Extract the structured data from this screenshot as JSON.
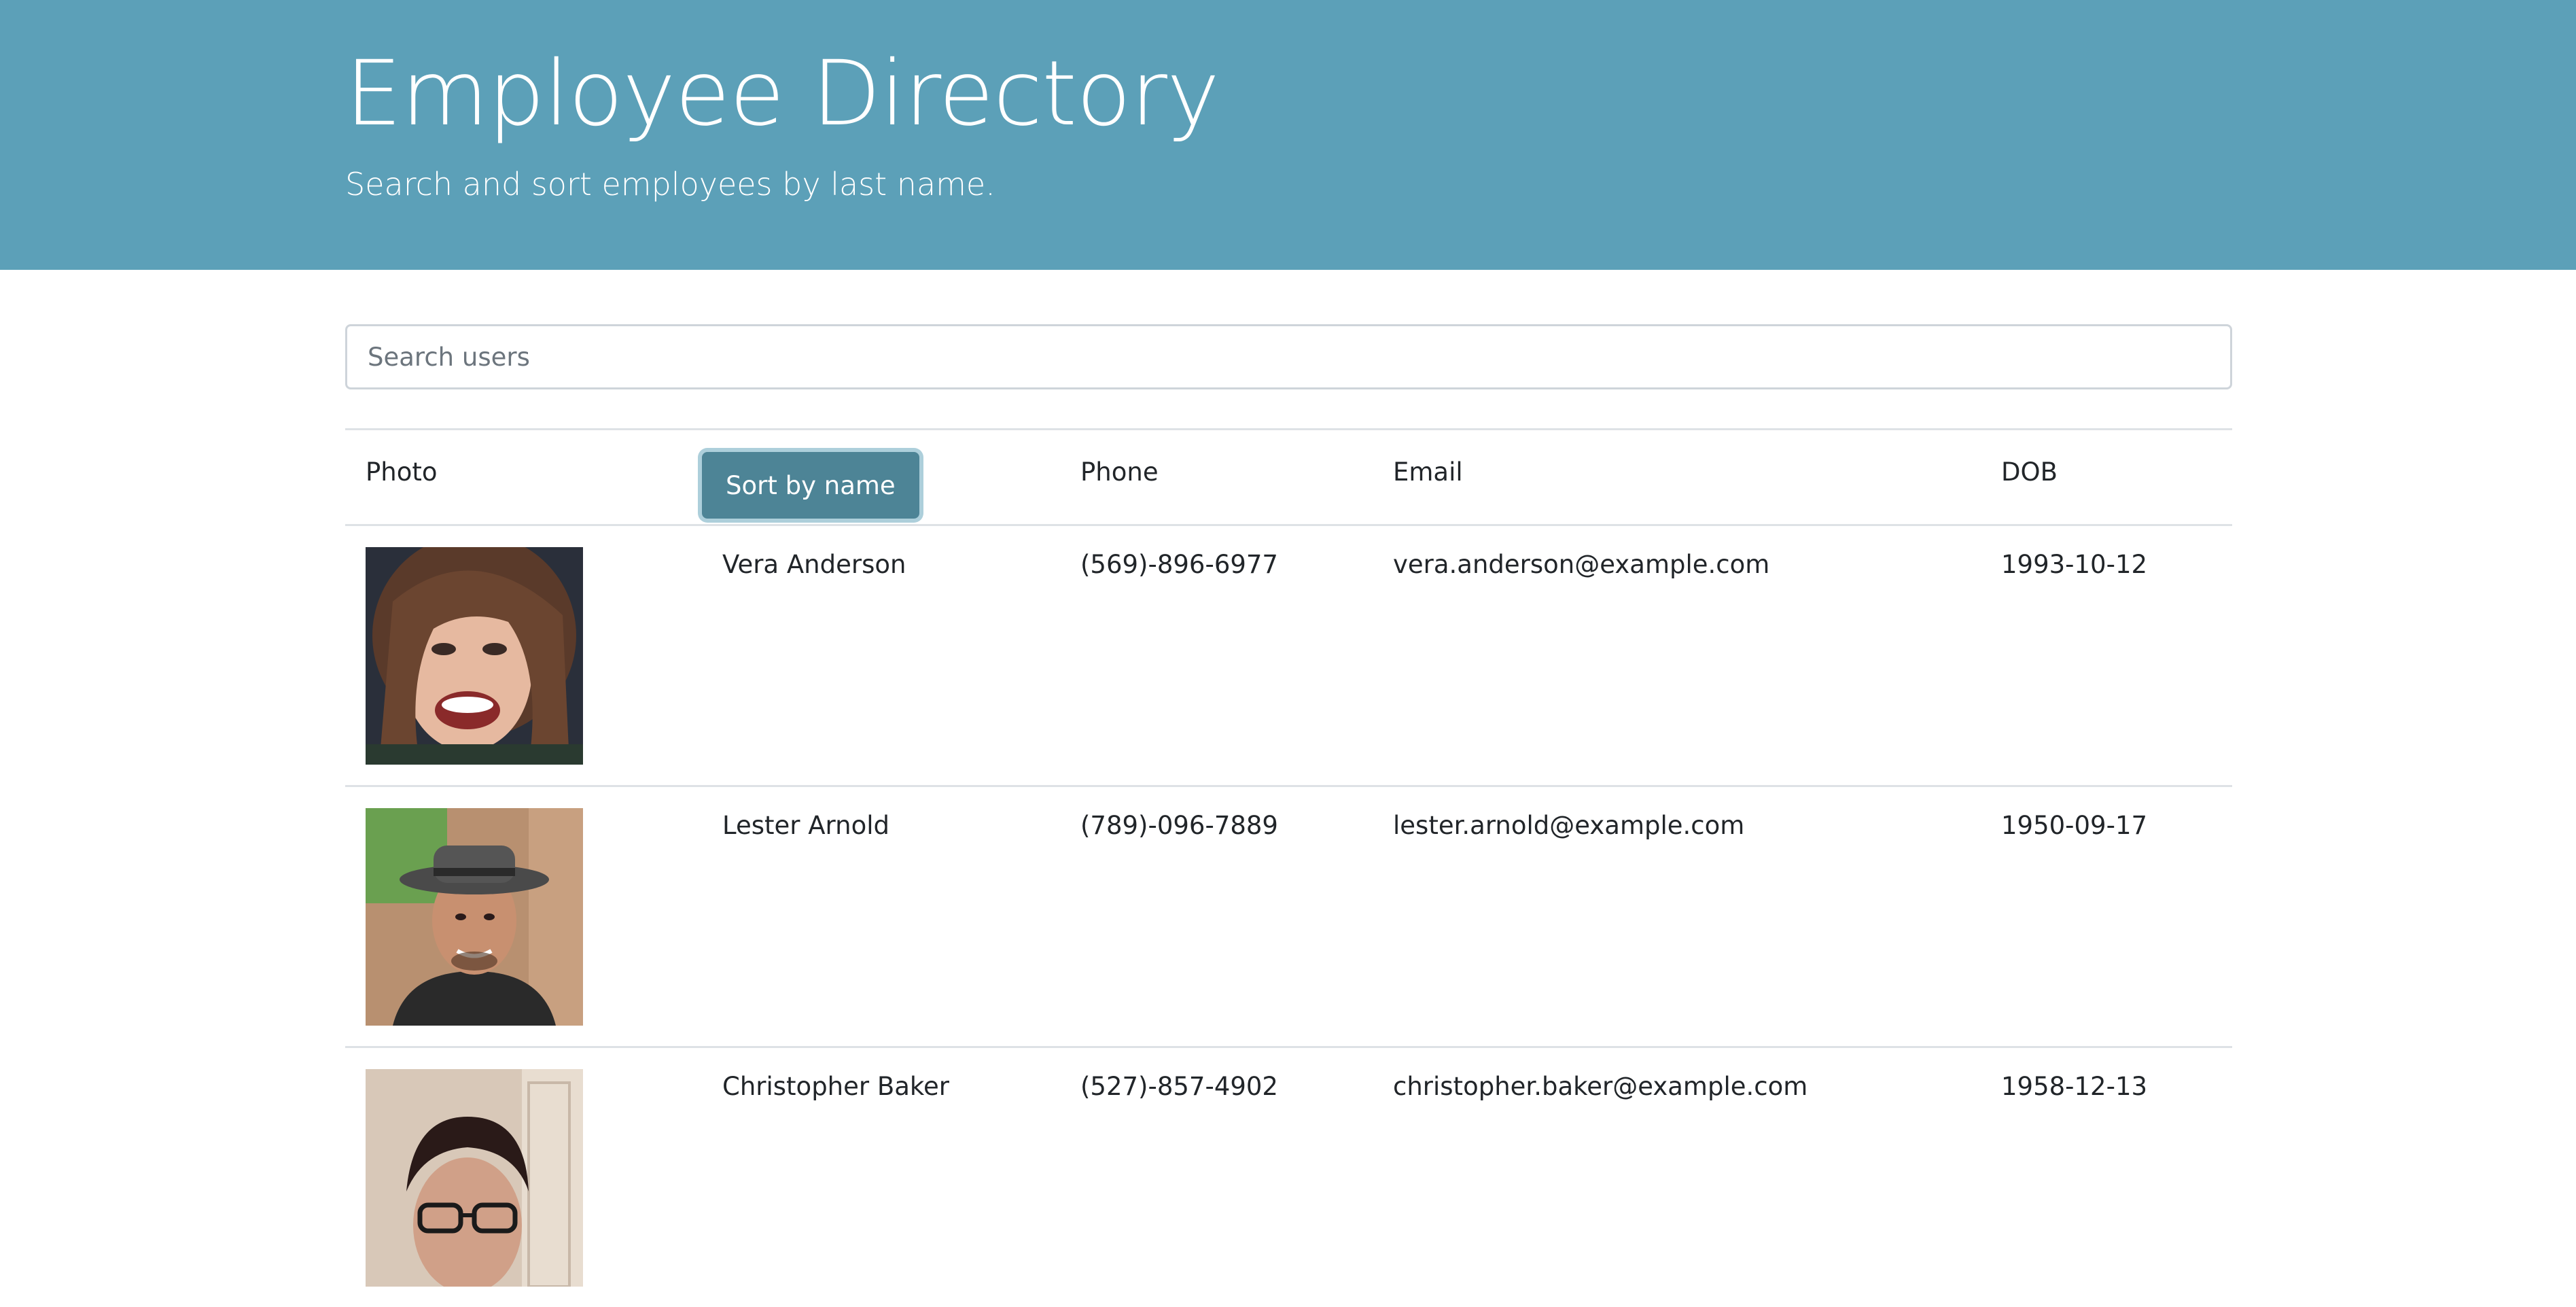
{
  "header": {
    "title": "Employee Directory",
    "subtitle": "Search and sort employees by last name."
  },
  "search": {
    "placeholder": "Search users",
    "value": ""
  },
  "table": {
    "headers": {
      "photo": "Photo",
      "sort_button": "Sort by name",
      "phone": "Phone",
      "email": "Email",
      "dob": "DOB"
    },
    "rows": [
      {
        "name": "Vera Anderson",
        "phone": "(569)-896-6977",
        "email": "vera.anderson@example.com",
        "dob": "1993-10-12",
        "photo_alt": "Vera Anderson photo"
      },
      {
        "name": "Lester Arnold",
        "phone": "(789)-096-7889",
        "email": "lester.arnold@example.com",
        "dob": "1950-09-17",
        "photo_alt": "Lester Arnold photo"
      },
      {
        "name": "Christopher Baker",
        "phone": "(527)-857-4902",
        "email": "christopher.baker@example.com",
        "dob": "1958-12-13",
        "photo_alt": "Christopher Baker photo"
      }
    ]
  },
  "colors": {
    "header_bg": "#5ca0b8",
    "button_bg": "#4d8496",
    "border": "#dee2e6"
  }
}
